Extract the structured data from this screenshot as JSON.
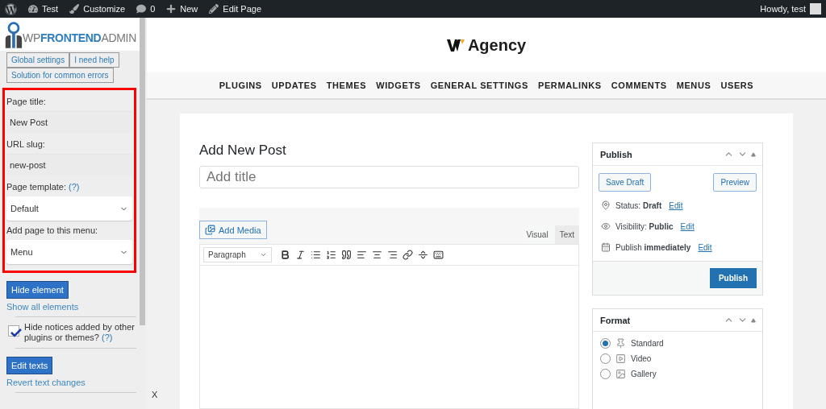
{
  "admin_bar": {
    "items": [
      {
        "kind": "wp"
      },
      {
        "kind": "site",
        "label": "Test"
      },
      {
        "kind": "customize",
        "label": "Customize"
      },
      {
        "kind": "comments",
        "label": "0"
      },
      {
        "kind": "new",
        "label": "New"
      },
      {
        "kind": "edit",
        "label": "Edit Page"
      }
    ],
    "greeting": "Howdy, test"
  },
  "sidebar": {
    "logo": [
      {
        "text": "WP",
        "kind": "light"
      },
      {
        "text": "FRONTEND",
        "kind": "strong"
      },
      {
        "text": "ADMIN",
        "kind": "light"
      }
    ],
    "tabs": [
      "Global settings",
      "I need help",
      "Solution for common errors"
    ],
    "fields": [
      {
        "label": "Page title:",
        "kind": "text",
        "value": "New Post"
      },
      {
        "label": "URL slug:",
        "kind": "text",
        "value": "new-post"
      },
      {
        "label": "Page template:",
        "help": "(?)",
        "kind": "select",
        "value": "Default"
      },
      {
        "label": "Add page to this menu:",
        "kind": "select",
        "value": "Menu"
      }
    ],
    "hide_button": "Hide element",
    "show_all_link": "Show all elements",
    "notices": {
      "label": "Hide notices added by other plugins or themes?",
      "help": "(?)",
      "checked": true
    },
    "edit_texts_button": "Edit texts",
    "revert_link": "Revert text changes",
    "close": "X"
  },
  "site": {
    "name": "Agency",
    "nav": [
      "PLUGINS",
      "UPDATES",
      "THEMES",
      "WIDGETS",
      "GENERAL SETTINGS",
      "PERMALINKS",
      "COMMENTS",
      "MENUS",
      "USERS"
    ]
  },
  "editor": {
    "heading": "Add New Post",
    "title_placeholder": "Add title",
    "add_media": "Add Media",
    "tabs": [
      {
        "label": "Visual",
        "selected": true
      },
      {
        "label": "Text",
        "selected": false
      }
    ],
    "format_select": "Paragraph",
    "toolbar": [
      {
        "kind": "bold"
      },
      {
        "kind": "italic"
      },
      {
        "kind": "bullets"
      },
      {
        "kind": "numbers"
      },
      {
        "kind": "quote"
      },
      {
        "kind": "left"
      },
      {
        "kind": "center"
      },
      {
        "kind": "right"
      },
      {
        "kind": "link"
      },
      {
        "kind": "more"
      },
      {
        "kind": "kitchen"
      }
    ]
  },
  "publish": {
    "title": "Publish",
    "save_draft": "Save Draft",
    "preview": "Preview",
    "rows": [
      {
        "kind": "status",
        "text": "Status: **Draft**",
        "link": "Edit"
      },
      {
        "kind": "visibility",
        "text": "Visibility: **Public**",
        "link": "Edit"
      },
      {
        "kind": "schedule",
        "text": "Publish **immediately**",
        "link": "Edit"
      }
    ],
    "button": "Publish"
  },
  "format": {
    "title": "Format",
    "options": [
      {
        "kind": "standard",
        "label": "Standard",
        "selected": true
      },
      {
        "kind": "video",
        "label": "Video",
        "selected": false
      },
      {
        "kind": "gallery",
        "label": "Gallery",
        "selected": false
      }
    ]
  }
}
